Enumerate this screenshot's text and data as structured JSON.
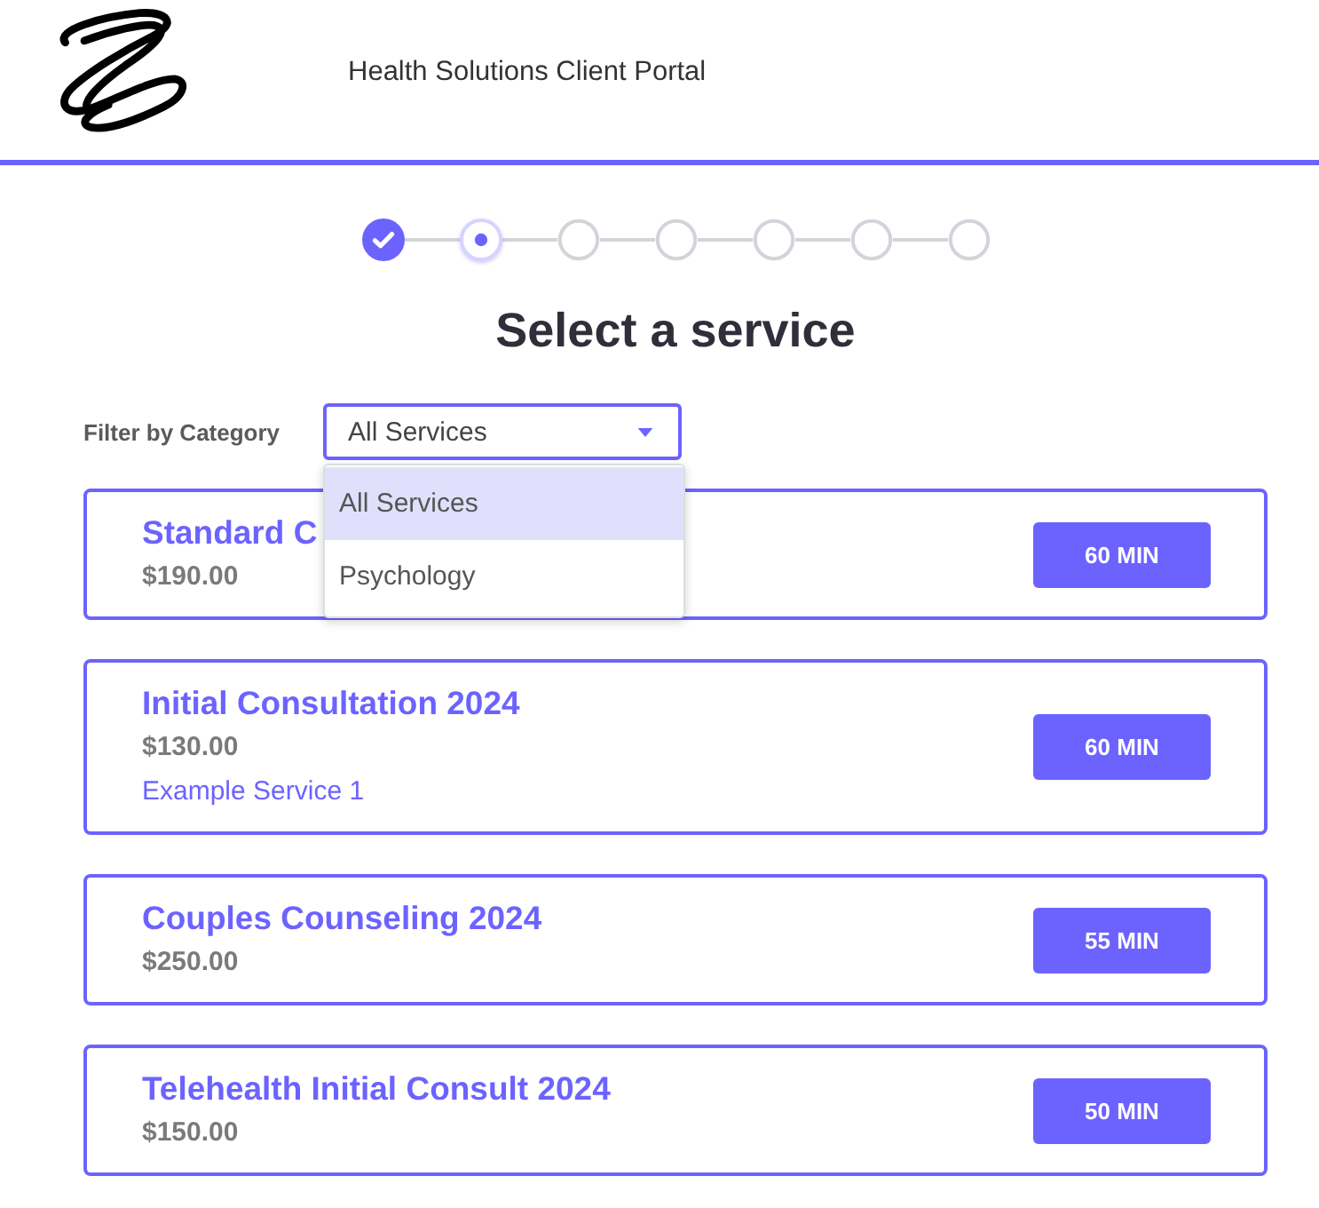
{
  "header": {
    "title": "Health Solutions Client Portal"
  },
  "steps": [
    {
      "kind": "done"
    },
    {
      "kind": "current"
    },
    {
      "kind": "pending"
    },
    {
      "kind": "pending"
    },
    {
      "kind": "pending"
    },
    {
      "kind": "pending"
    },
    {
      "kind": "pending"
    }
  ],
  "heading": "Select a service",
  "filter": {
    "label": "Filter by Category",
    "value": "All Services",
    "expanded": true,
    "options": [
      {
        "label": "All Services",
        "selected": true
      },
      {
        "label": "Psychology",
        "selected": false
      }
    ]
  },
  "services": [
    {
      "name": "Standard C",
      "price": "$190.00",
      "duration": "60 MIN"
    },
    {
      "name": "Initial Consultation 2024",
      "price": "$130.00",
      "description": "Example Service 1",
      "duration": "60 MIN"
    },
    {
      "name": "Couples Counseling 2024",
      "price": "$250.00",
      "duration": "55 MIN"
    },
    {
      "name": "Telehealth Initial Consult 2024",
      "price": "$150.00",
      "duration": "50 MIN"
    }
  ]
}
